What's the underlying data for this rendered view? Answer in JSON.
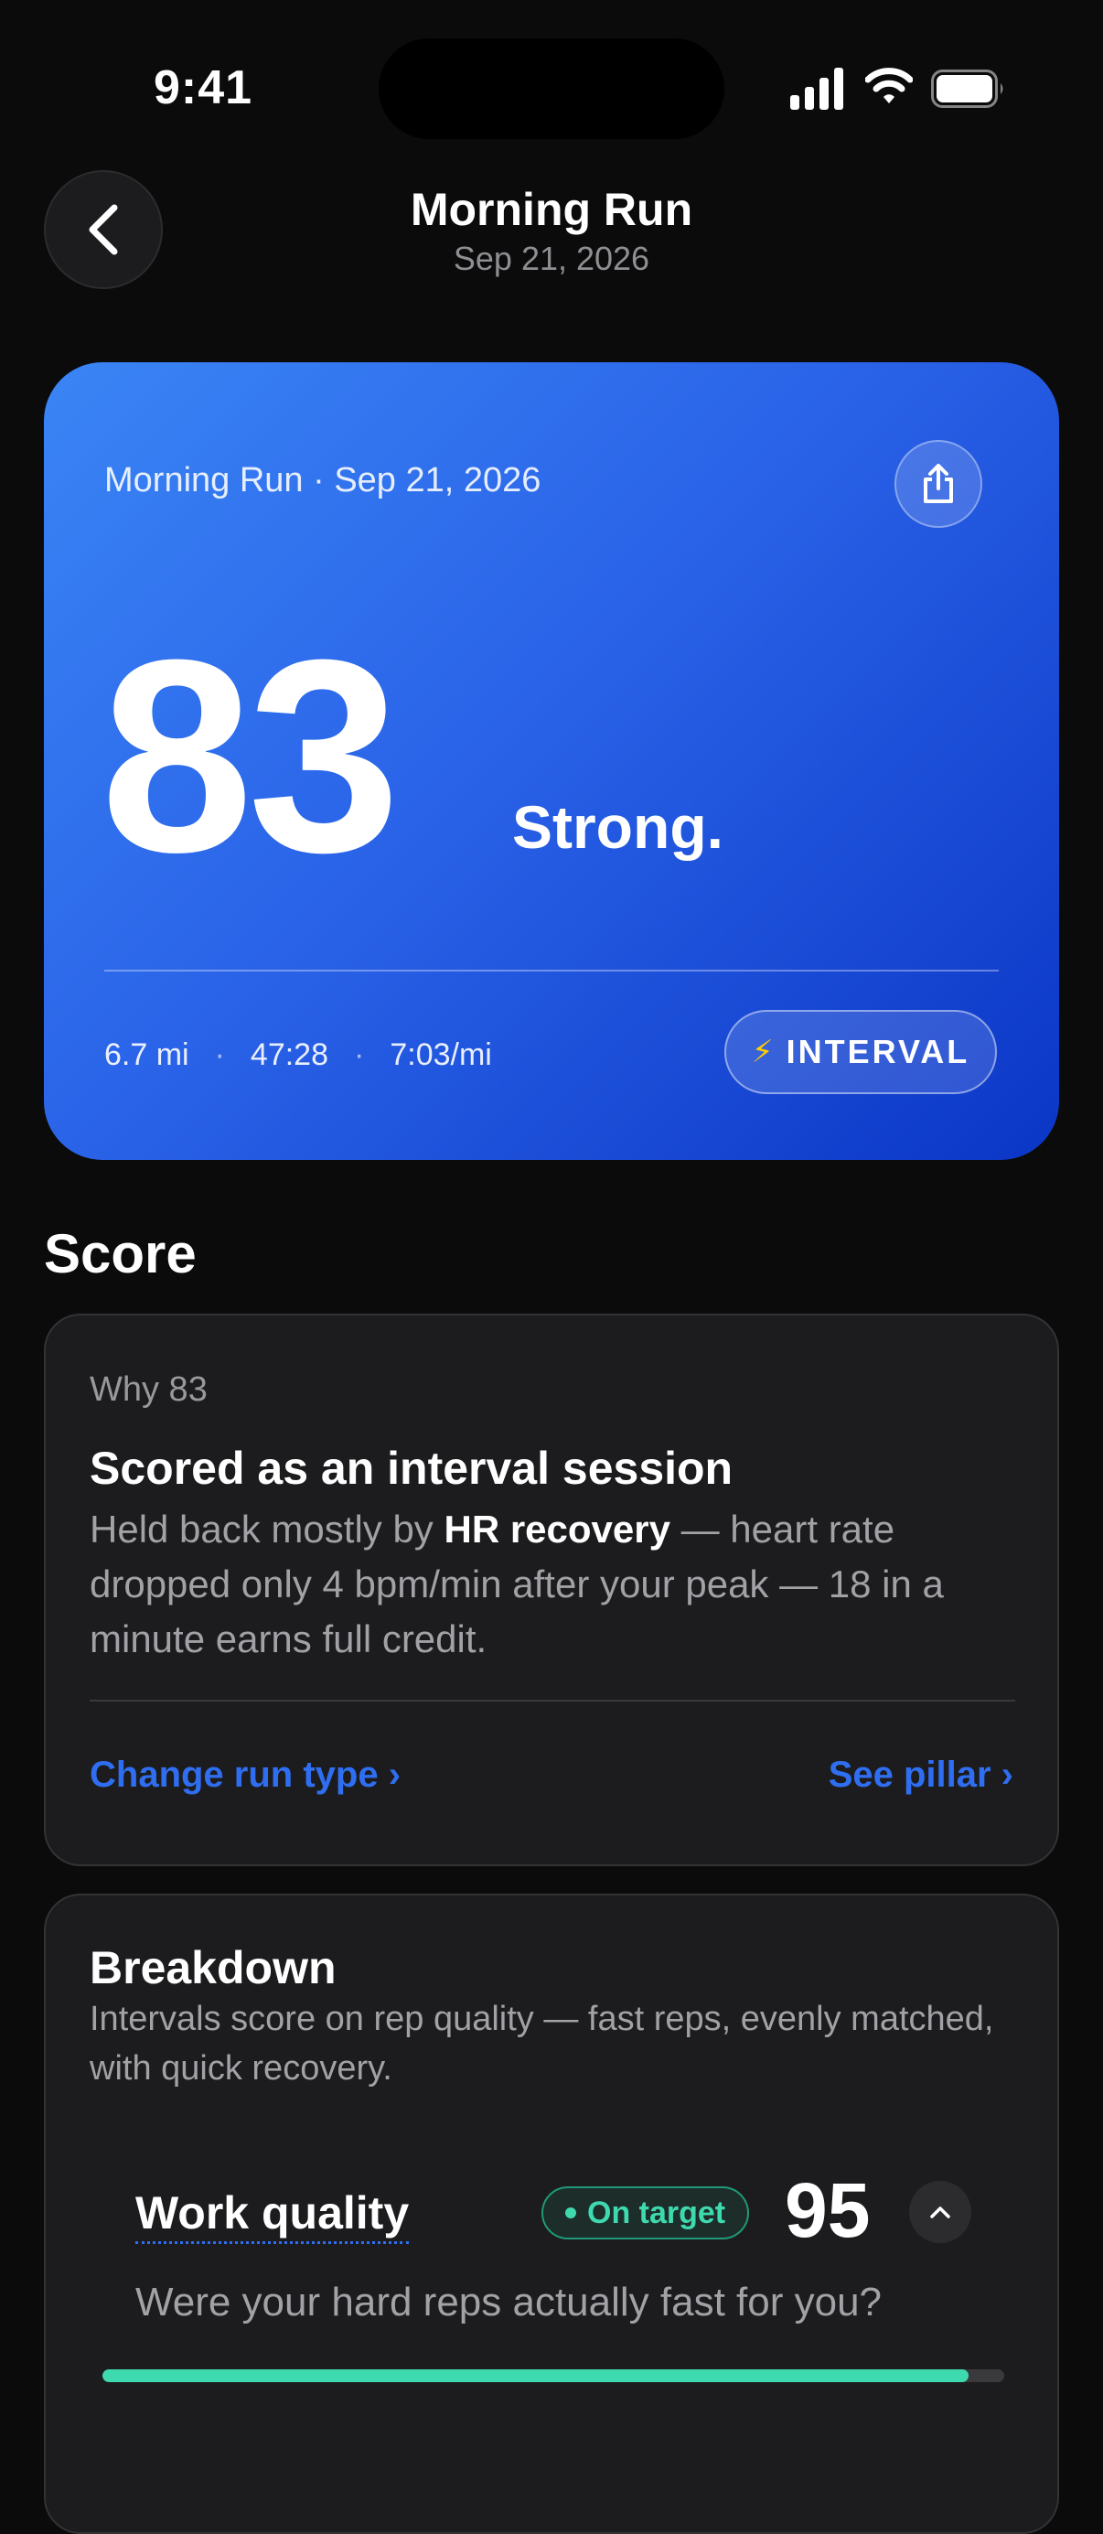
{
  "status_bar": {
    "time": "9:41"
  },
  "nav": {
    "title": "Morning Run",
    "subtitle": "Sep 21, 2026"
  },
  "hero": {
    "label": "Morning Run · Sep 21, 2026",
    "score": "83",
    "verdict": "Strong.",
    "stats": {
      "distance": "6.7 mi",
      "sep": "·",
      "duration": "47:28",
      "pace": "7:03/mi"
    },
    "badge": "INTERVAL",
    "gradient": [
      "#3a85f5",
      "#0b36c6"
    ]
  },
  "section_title": "Score",
  "why_card": {
    "eyebrow": "Why 83",
    "title": "Scored as an interval session",
    "body_prefix": "Held back mostly by ",
    "body_bold": "HR recovery",
    "body_suffix": " — heart rate dropped only 4 bpm/min after your peak — 18 in a minute earns full credit.",
    "link_left": "Change run type ›",
    "link_right": "See pillar ›"
  },
  "breakdown": {
    "title": "Breakdown",
    "description": "Intervals score on rep quality — fast reps, evenly matched, with quick recovery.",
    "pillar": {
      "name": "Work quality",
      "status": "On target",
      "score": "95",
      "question": "Were your hard reps actually fast for you?",
      "progress": 0.96
    }
  },
  "colors": {
    "accent": "#2f6ef0",
    "success": "#3fd9b0",
    "background": "#0b0b0b"
  }
}
